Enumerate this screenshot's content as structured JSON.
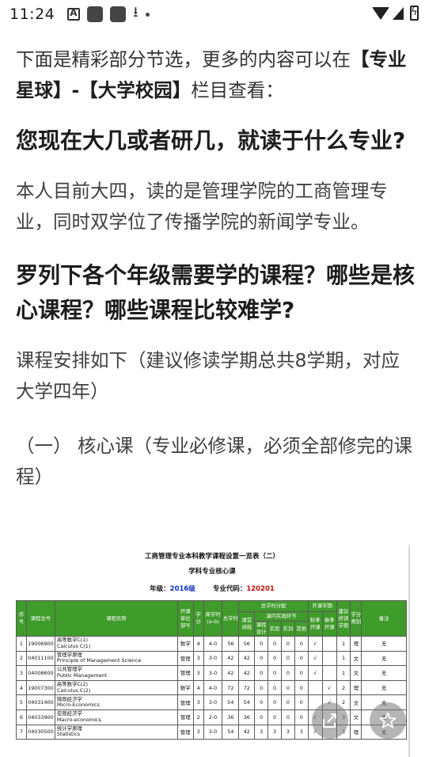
{
  "status_bar": {
    "time": "11:24",
    "icons": [
      "notification-a-icon",
      "app-icon",
      "app-icon",
      "download-icon",
      "dot-icon",
      "wifi-icon",
      "signal-icon",
      "battery-charging-icon"
    ]
  },
  "article": {
    "intro_prefix": "下面是精彩部分节选，更多的内容可以在",
    "intro_link": "【专业星球】-【大学校园】",
    "intro_suffix": "栏目查看：",
    "q1": "您现在大几或者研几，就读于什么专业?",
    "a1": "本人目前大四，读的是管理学院的工商管理专业，同时双学位了传播学院的新闻学专业。",
    "q2": "罗列下各个年级需要学的课程？哪些是核心课程？哪些课程比较难学?",
    "a2": "课程安排如下（建议修读学期总共8学期，对应大学四年）",
    "core_heading": "（一） 核心课（专业必修课，必须全部修完的课程）"
  },
  "table_image": {
    "title": "工商管理专业本科教学课程设置一览表（二）",
    "subtitle": "学科专业核心课",
    "grade_label": "年级：",
    "grade_value": "2016级",
    "code_label": "专业代码：",
    "code_value": "120201",
    "headers": {
      "seq": "序号",
      "code": "课程总号",
      "name": "课程名称",
      "dept": "开课单位部号",
      "credit": "学分",
      "weekly": "周学时(a-b)",
      "total": "总学时",
      "dist": "总学时分配",
      "lecture": "课堂讲授",
      "practice": "课内实践环节",
      "design": "课程设计",
      "lab": "实验",
      "training": "实训",
      "other": "其他",
      "term": "开课学期",
      "autumn": "秋季开课",
      "spring": "春季开课",
      "suggest": "建议修读学期",
      "category": "学分类别",
      "remark": "备注"
    },
    "rows": [
      {
        "seq": "1",
        "code": "19006900",
        "cn": "高等数学C(1)",
        "en": "Calculus C(1)",
        "dept": "数学",
        "credit": "4",
        "weekly": "4-0",
        "total": "56",
        "lecture": "56",
        "design": "0",
        "lab": "0",
        "training": "0",
        "other": "0",
        "autumn": "√",
        "spring": "",
        "suggest": "1",
        "category": "理",
        "remark": "无"
      },
      {
        "seq": "2",
        "code": "04011100",
        "cn": "管理学原理",
        "en": "Principle of Management Science",
        "dept": "管理",
        "credit": "3",
        "weekly": "3-0",
        "total": "42",
        "lecture": "42",
        "design": "0",
        "lab": "0",
        "training": "0",
        "other": "0",
        "autumn": "√",
        "spring": "",
        "suggest": "1",
        "category": "文",
        "remark": "无"
      },
      {
        "seq": "3",
        "code": "04008600",
        "cn": "公共管理学",
        "en": "Public Management",
        "dept": "管理",
        "credit": "3",
        "weekly": "3-0",
        "total": "42",
        "lecture": "42",
        "design": "0",
        "lab": "0",
        "training": "0",
        "other": "0",
        "autumn": "√",
        "spring": "",
        "suggest": "1",
        "category": "文",
        "remark": "无"
      },
      {
        "seq": "4",
        "code": "19007300",
        "cn": "高等数学C(2)",
        "en": "Calculus C(2)",
        "dept": "数学",
        "credit": "4",
        "weekly": "4-0",
        "total": "72",
        "lecture": "72",
        "design": "0",
        "lab": "0",
        "training": "0",
        "other": "0",
        "autumn": "",
        "spring": "√",
        "suggest": "2",
        "category": "理",
        "remark": "无"
      },
      {
        "seq": "5",
        "code": "04031400",
        "cn": "微观经济学",
        "en": "Micro-Economics",
        "dept": "管理",
        "credit": "3",
        "weekly": "3-0",
        "total": "54",
        "lecture": "54",
        "design": "0",
        "lab": "0",
        "training": "0",
        "other": "0",
        "autumn": "",
        "spring": "√",
        "suggest": "2",
        "category": "文",
        "remark": "无"
      },
      {
        "seq": "6",
        "code": "04033900",
        "cn": "宏观经济学",
        "en": "Macro-economics",
        "dept": "管理",
        "credit": "2",
        "weekly": "2-0",
        "total": "36",
        "lecture": "36",
        "design": "0",
        "lab": "0",
        "training": "0",
        "other": "0",
        "autumn": "√",
        "spring": "",
        "suggest": "3",
        "category": "文",
        "remark": "无"
      },
      {
        "seq": "7",
        "code": "04030500",
        "cn": "统计学原理",
        "en": "Statistics",
        "dept": "管理",
        "credit": "3",
        "weekly": "3-0",
        "total": "54",
        "lecture": "42",
        "design": "3",
        "lab": "3",
        "training": "3",
        "other": "3",
        "autumn": "√",
        "spring": "",
        "suggest": "3",
        "category": "理",
        "remark": "无"
      }
    ]
  },
  "fabs": {
    "share_icon": "share-icon",
    "star_icon": "star-icon"
  }
}
